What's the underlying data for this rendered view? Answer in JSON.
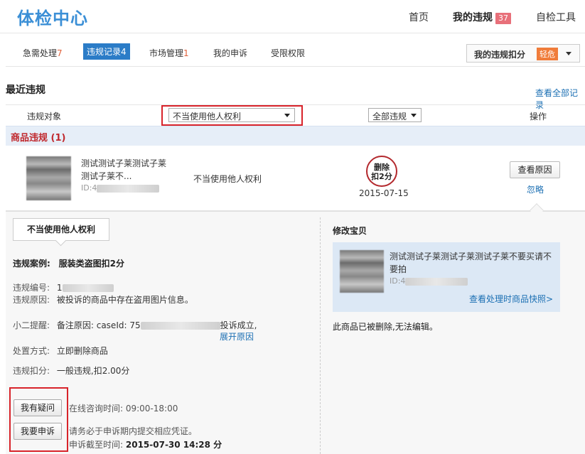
{
  "header": {
    "logo": "体检中心",
    "nav": {
      "home": "首页",
      "my_violations": "我的违规",
      "my_violations_count": "37",
      "self_check": "自检工具"
    }
  },
  "subtabs": [
    {
      "label": "急需处理",
      "count": "7"
    },
    {
      "label": "违规记录",
      "count": "4"
    },
    {
      "label": "市场管理",
      "count": "1"
    },
    {
      "label": "我的申诉",
      "count": ""
    },
    {
      "label": "受限权限",
      "count": ""
    }
  ],
  "score": {
    "label": "我的违规扣分",
    "level": "轻危"
  },
  "recent": {
    "title": "最近违规",
    "view_all": "查看全部记录"
  },
  "table_header": {
    "object": "违规对象",
    "type_filter": "不当使用他人权利",
    "status_filter": "全部违规",
    "action": "操作"
  },
  "group": {
    "title": "商品违规 (1)"
  },
  "item": {
    "name": "测试测试子莱测试子莱测试子莱不...",
    "id_prefix": "ID:4",
    "reason": "不当使用他人权利",
    "stamp_line1": "删除",
    "stamp_line2": "扣2分",
    "date": "2015-07-15",
    "view_cause": "查看原因",
    "ignore": "忽略"
  },
  "detail": {
    "tag": "不当使用他人权利",
    "case_label": "违规案例:",
    "case_value": "服装类盗图扣2分",
    "no_label": "违规编号:",
    "no_value": "1",
    "cause_label": "违规原因:",
    "cause_value": "被投诉的商品中存在盗用图片信息。",
    "remind_label": "小二提醒:",
    "remind_value_prefix": "备注原因: caseId: 75",
    "remind_value_suffix": "投诉成立,",
    "expand": "展开原因",
    "handle_label": "处置方式:",
    "handle_value": "立即删除商品",
    "deduct_label": "违规扣分:",
    "deduct_value": "一般违规,扣2.00分",
    "btn_question": "我有疑问",
    "btn_appeal": "我要申诉",
    "consult_time": "在线咨询时间: 09:00-18:00",
    "appeal_tip": "请务必于申诉期内提交相应凭证。",
    "deadline_label": "申诉截至时间:",
    "deadline_value": "2015-07-30 14:28 分"
  },
  "modify": {
    "title": "修改宝贝",
    "name": "测试测试子莱测试子莱测试子莱不要买请不要拍",
    "id_prefix": "ID:4",
    "snapshot_link": "查看处理时商品快照>",
    "note": "此商品已被删除,无法编辑。"
  }
}
